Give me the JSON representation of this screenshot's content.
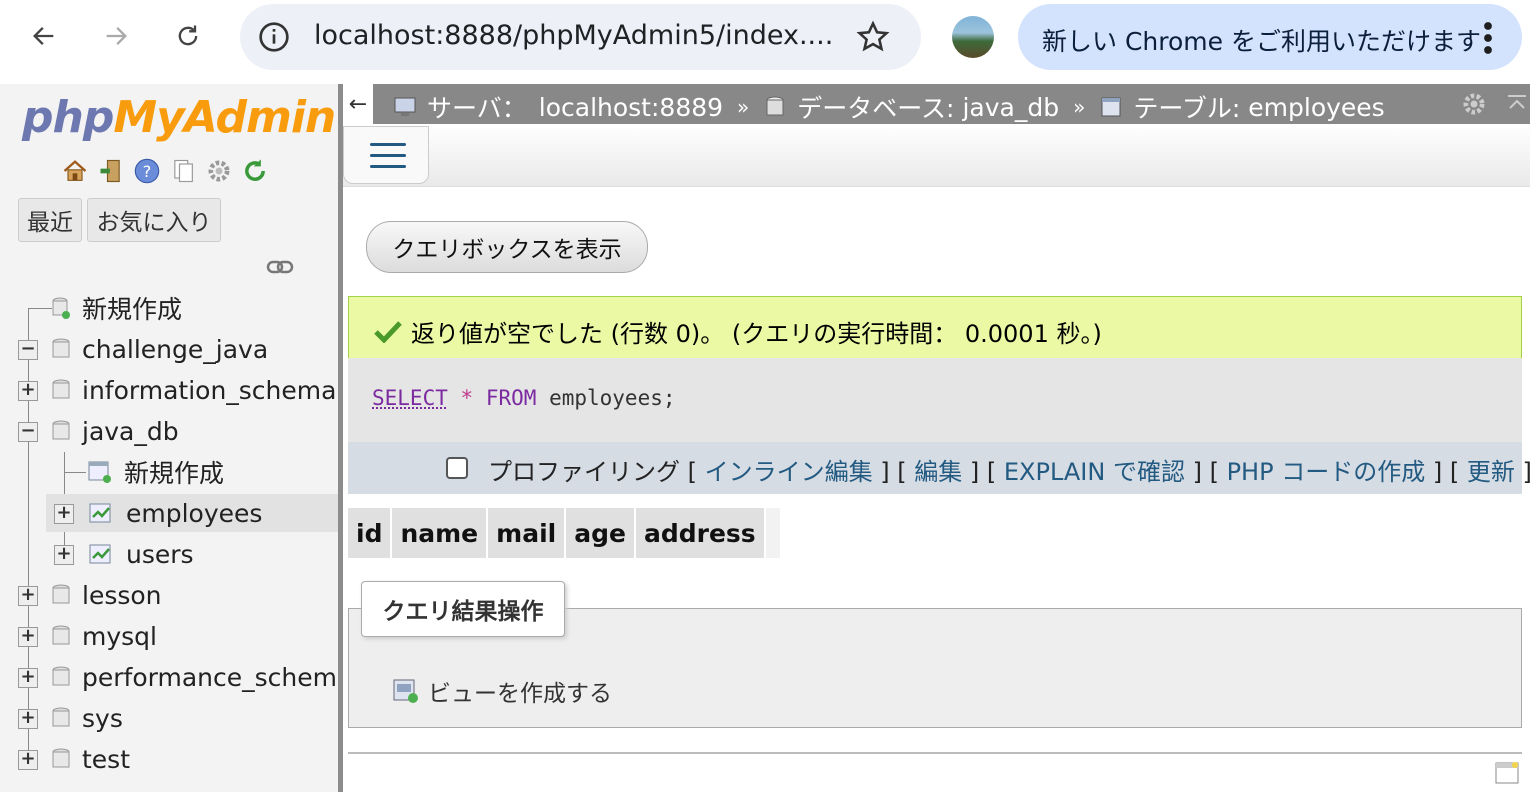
{
  "browser": {
    "url": "localhost:8888/phpMyAdmin5/index....",
    "update_label": "新しい Chrome をご利用いただけます"
  },
  "sidebar": {
    "logo_part1": "php",
    "logo_part2": "MyAdmin",
    "tab_recent": "最近",
    "tab_favorites": "お気に入り",
    "tree": [
      {
        "label": "新規作成"
      },
      {
        "label": "challenge_java",
        "state": "expanded"
      },
      {
        "label": "information_schema",
        "state": "collapsed"
      },
      {
        "label": "java_db",
        "state": "expanded"
      },
      {
        "label": "新規作成"
      },
      {
        "label": "employees",
        "state": "collapsed"
      },
      {
        "label": "users",
        "state": "collapsed"
      },
      {
        "label": "lesson",
        "state": "collapsed"
      },
      {
        "label": "mysql",
        "state": "collapsed"
      },
      {
        "label": "performance_schema",
        "state": "collapsed"
      },
      {
        "label": "sys",
        "state": "collapsed"
      },
      {
        "label": "test",
        "state": "collapsed"
      }
    ]
  },
  "breadcrumb": {
    "server_label": "サーバ：",
    "server_value": "localhost:8889",
    "sep": "»",
    "db_label": "データベース:",
    "db_value": "java_db",
    "table_label": "テーブル:",
    "table_value": "employees"
  },
  "main": {
    "show_querybox": "クエリボックスを表示",
    "success_message": "返り値が空でした (行数 0)。 (クエリの実行時間： 0.0001 秒。)",
    "sql": {
      "select": "SELECT",
      "star": "*",
      "from": "FROM",
      "table": "employees;"
    },
    "ops": {
      "profiling": "プロファイリング",
      "inline_edit": "インライン編集",
      "edit": "編集",
      "explain": "EXPLAIN で確認",
      "php_code": "PHP コードの作成",
      "refresh": "更新"
    },
    "columns": [
      "id",
      "name",
      "mail",
      "age",
      "address"
    ],
    "query_ops_legend": "クエリ結果操作",
    "create_view": "ビューを作成する"
  }
}
